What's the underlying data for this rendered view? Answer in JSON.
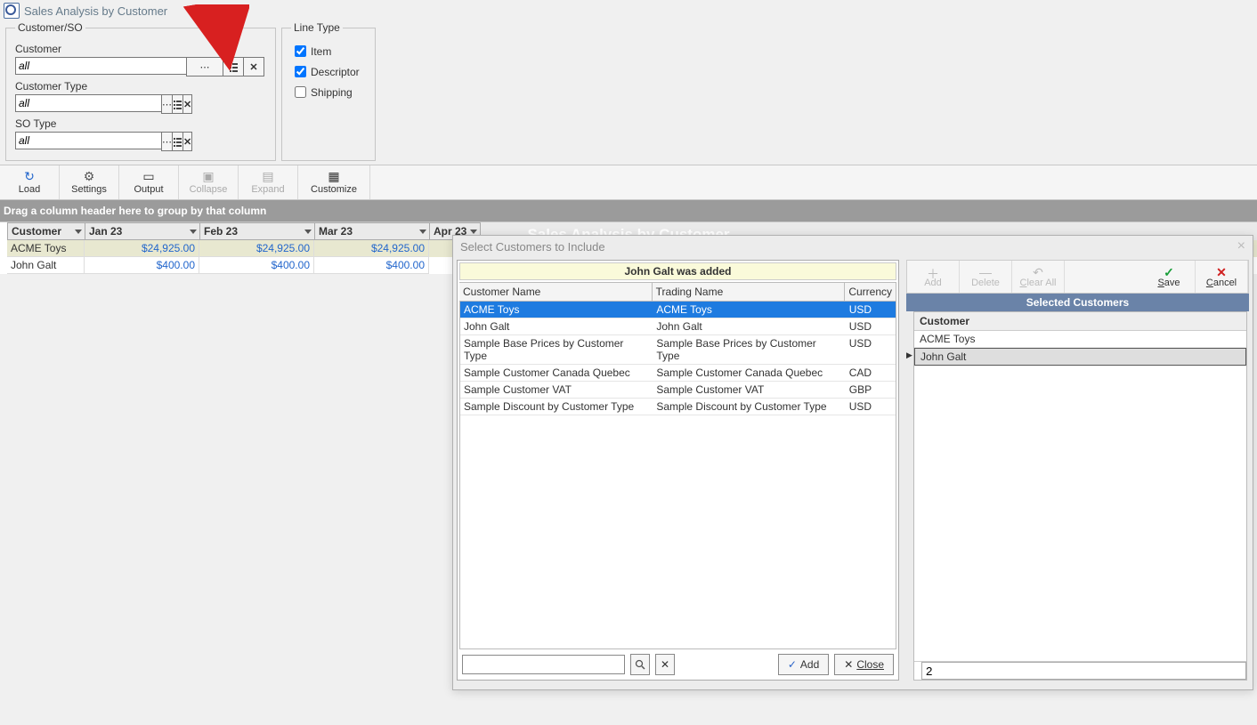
{
  "window": {
    "title": "Sales Analysis by Customer"
  },
  "customer_so": {
    "legend": "Customer/SO",
    "fields": [
      {
        "label": "Customer",
        "value": "all"
      },
      {
        "label": "Customer Type",
        "value": "all"
      },
      {
        "label": "SO Type",
        "value": "all"
      }
    ]
  },
  "line_type": {
    "legend": "Line Type",
    "items": [
      "Item",
      "Descriptor",
      "Shipping"
    ],
    "checked": [
      true,
      true,
      false
    ]
  },
  "toolbar": [
    "Load",
    "Settings",
    "Output",
    "Collapse",
    "Expand",
    "Customize"
  ],
  "group_hint": "Drag a column header here to group by that column",
  "ghost_title": "Sales Analysis by Customer",
  "grid": {
    "months": [
      "Jan 23",
      "Feb 23",
      "Mar 23",
      "Apr 23"
    ],
    "customer_header": "Customer",
    "rows": [
      {
        "name": "ACME Toys",
        "values": [
          "$24,925.00",
          "$24,925.00",
          "$24,925.00"
        ]
      },
      {
        "name": "John Galt",
        "values": [
          "$400.00",
          "$400.00",
          "$400.00"
        ]
      }
    ]
  },
  "dialog": {
    "title": "Select Customers to Include",
    "status": "John Galt was added",
    "columns": [
      "Customer Name",
      "Trading Name",
      "Currency"
    ],
    "rows": [
      [
        "ACME Toys",
        "ACME Toys",
        "USD"
      ],
      [
        "John Galt",
        "John Galt",
        "USD"
      ],
      [
        "Sample Base Prices by Customer Type",
        "Sample Base Prices by Customer Type",
        "USD"
      ],
      [
        "Sample Customer Canada Quebec",
        "Sample Customer Canada Quebec",
        "CAD"
      ],
      [
        "Sample Customer VAT",
        "Sample Customer VAT",
        "GBP"
      ],
      [
        "Sample Discount by Customer Type",
        "Sample Discount by Customer Type",
        "USD"
      ]
    ],
    "selected_row": 0,
    "add_btn": "Add",
    "close_btn": "Close",
    "rp_buttons": [
      "Add",
      "Delete",
      "Clear All",
      "Save",
      "Cancel"
    ],
    "selected_header": "Selected Customers",
    "selcol": "Customer",
    "selected": [
      "ACME Toys",
      "John Galt"
    ],
    "selected_active": 1,
    "count": "2"
  }
}
